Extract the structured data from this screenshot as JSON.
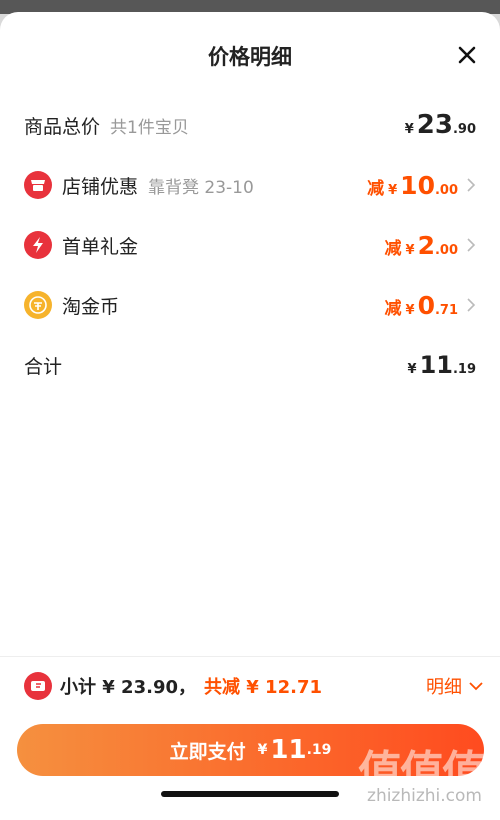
{
  "sheet": {
    "title": "价格明细"
  },
  "rows": [
    {
      "label": "商品总价",
      "sub": "共1件宝贝",
      "currency": "¥",
      "int": "23",
      "dec": ".90"
    },
    {
      "label": "店铺优惠",
      "sub": "靠背凳 23-10",
      "minus": "减",
      "currency": "¥",
      "int": "10",
      "dec": ".00"
    },
    {
      "label": "首单礼金",
      "minus": "减",
      "currency": "¥",
      "int": "2",
      "dec": ".00"
    },
    {
      "label": "淘金币",
      "minus": "减",
      "currency": "¥",
      "int": "0",
      "dec": ".71"
    },
    {
      "label": "合计",
      "currency": "¥",
      "int": "11",
      "dec": ".19"
    }
  ],
  "summary": {
    "subtotal": "小计 ¥ 23.90，",
    "saved": "共减 ¥ 12.71",
    "detail_label": "明细"
  },
  "pay": {
    "label": "立即支付",
    "currency": "¥",
    "int": "11",
    "dec": ".19"
  },
  "watermark": {
    "text": "值值值",
    "domain": "zhizhizhi.com"
  },
  "colors": {
    "accent": "#ff5000",
    "shop_icon": "#e8323c",
    "gift_icon": "#e8323c",
    "coin_icon": "#f6b32c"
  }
}
